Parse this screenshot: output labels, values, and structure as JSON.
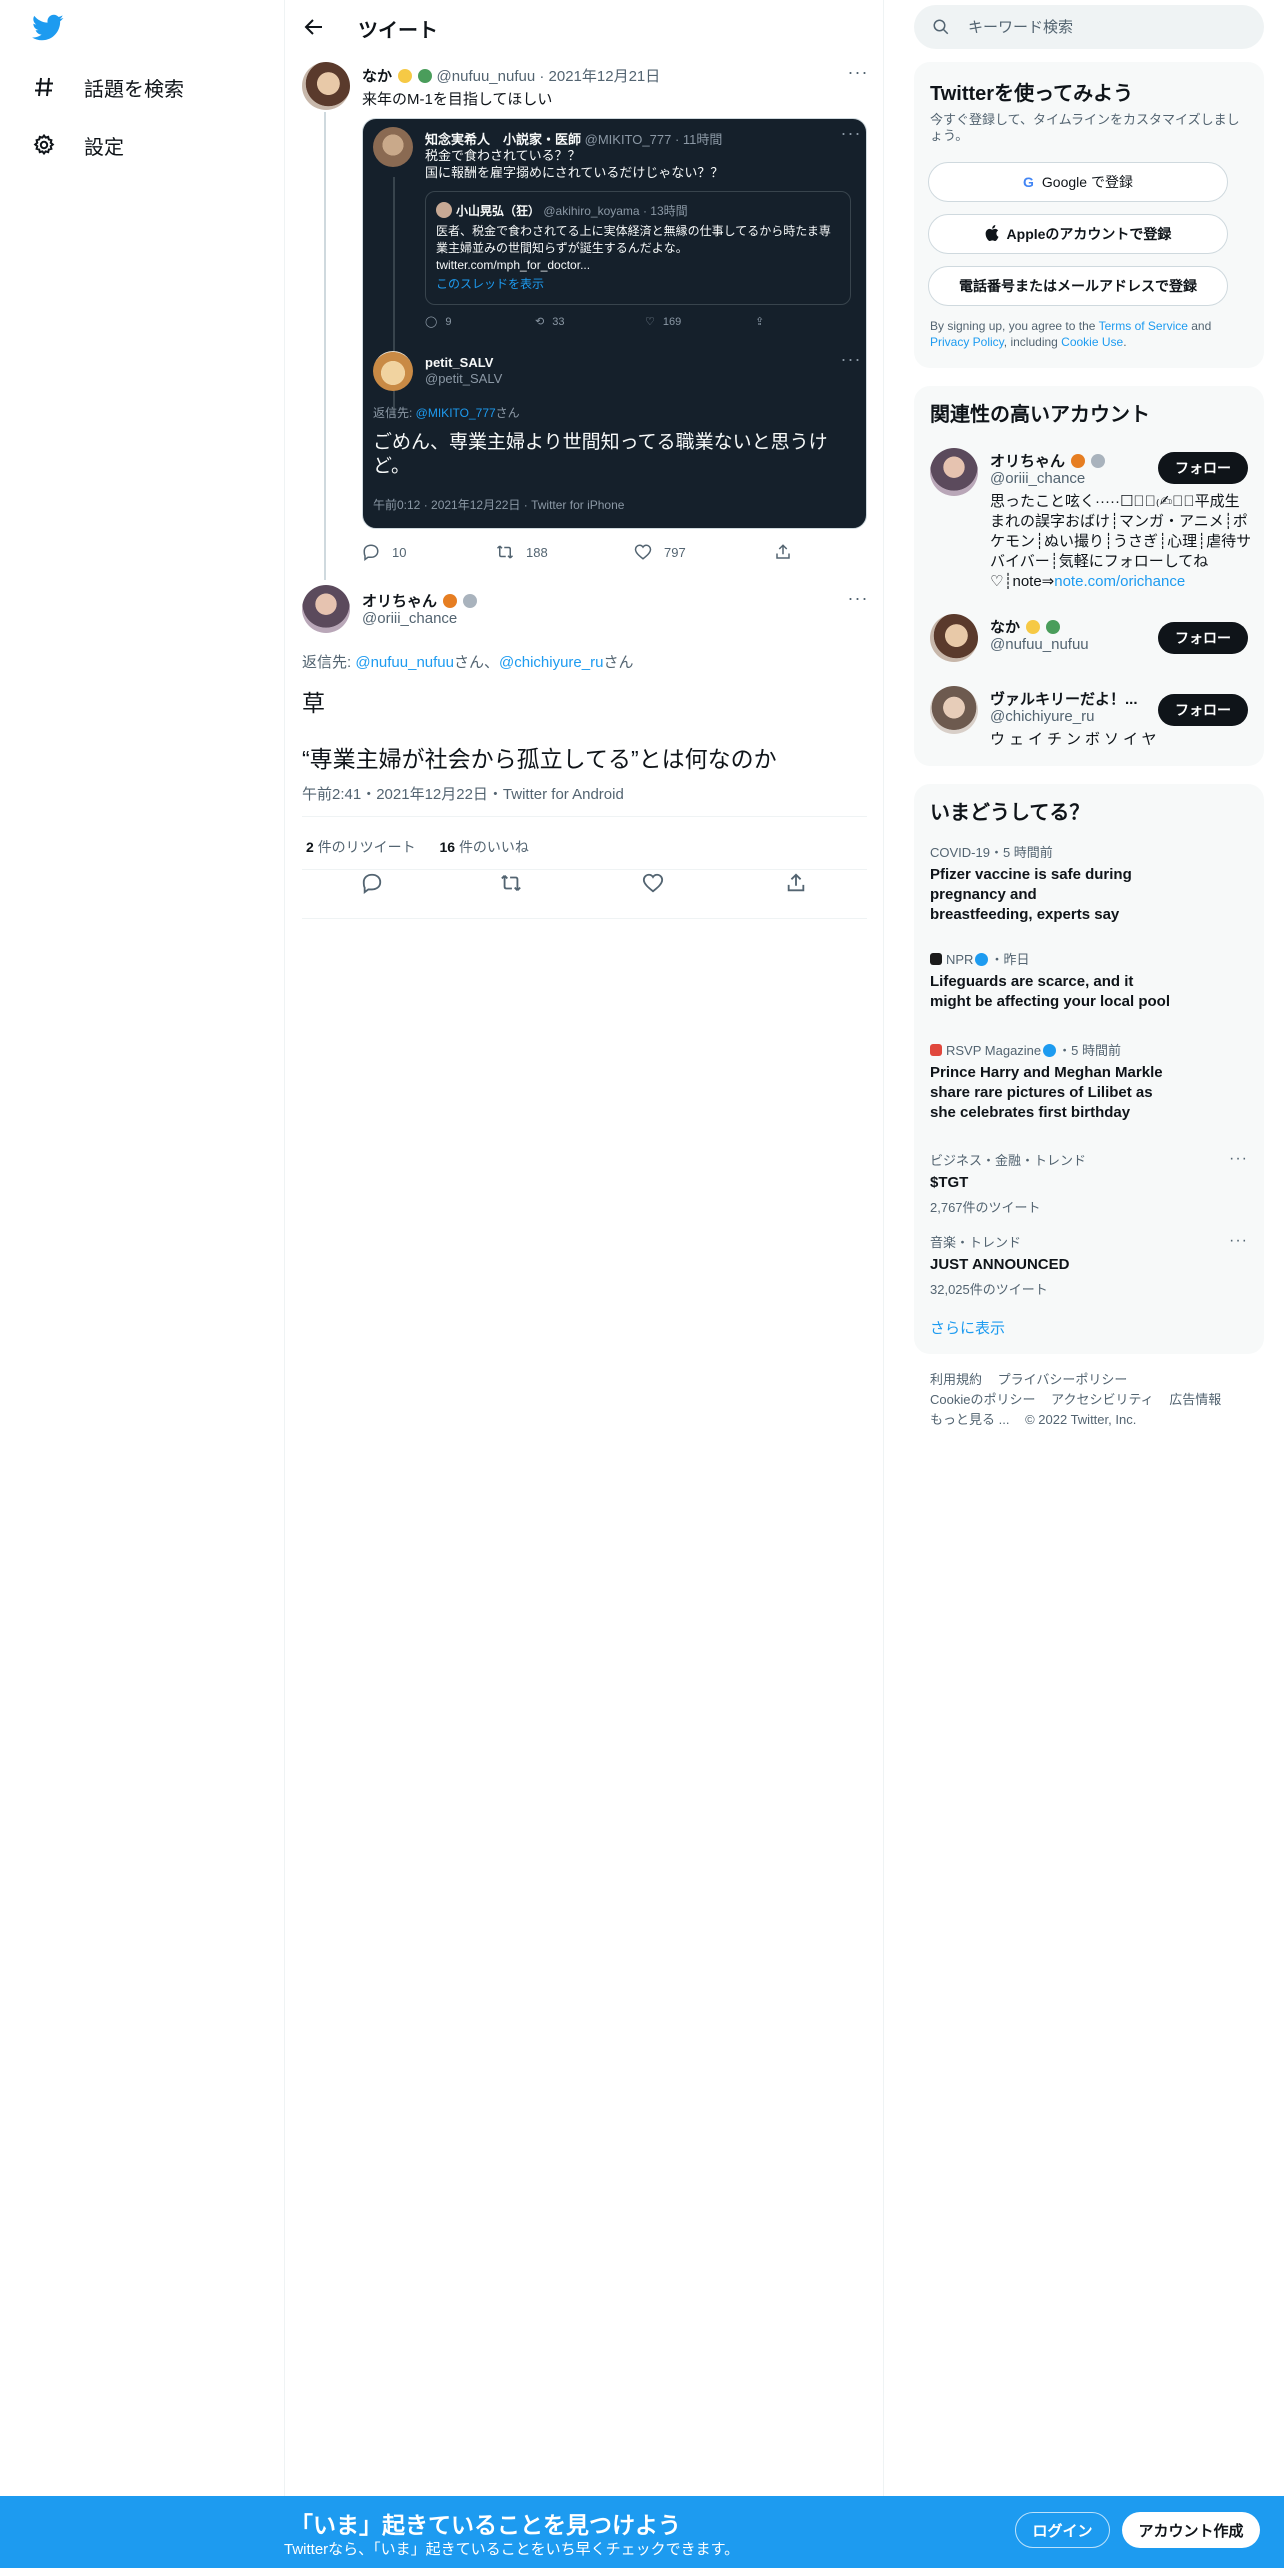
{
  "nav": {
    "explore_label": "話題を検索",
    "settings_label": "設定"
  },
  "header": {
    "title": "ツイート"
  },
  "parent_tweet": {
    "display_name": "なか",
    "handle": "@nufuu_nufuu",
    "date": "2021年12月21日",
    "text": "来年のM-1を目指してほしい",
    "embedded": {
      "top": {
        "name": "知念実希人　小説家・医師",
        "handle": "@MIKITO_777",
        "time": "11時間",
        "text1": "税金で食わされている？？",
        "text2": "国に報酬を雇字搦めにされているだけじゃない？？"
      },
      "quote": {
        "name": "小山晃弘（狂）",
        "handle": "@akihiro_koyama",
        "time": "13時間",
        "text": "医者、税金で食わされてる上に実体経済と無縁の仕事してるから時たま専業主婦並みの世間知らずが誕生するんだよな。",
        "link": "twitter.com/mph_for_doctor...",
        "thread": "このスレッドを表示"
      },
      "top_counts": {
        "replies": "9",
        "retweets": "33",
        "likes": "169"
      },
      "reply": {
        "name": "petit_SALV",
        "handle": "@petit_SALV",
        "reply_prefix": "返信先: ",
        "reply_to": "@MIKITO_777",
        "reply_suffix": "さん",
        "text": "ごめん、専業主婦より世間知ってる職業ないと思うけど。",
        "meta": "午前0:12 · 2021年12月22日 · Twitter for iPhone"
      }
    },
    "counts": {
      "replies": "10",
      "retweets": "188",
      "likes": "797"
    }
  },
  "main_tweet": {
    "display_name": "オリちゃん",
    "handle": "@oriii_chance",
    "reply_prefix": "返信先: ",
    "reply_to_1": "@nufuu_nufuu",
    "reply_mid": "さん、",
    "reply_to_2": "@chichiyure_ru",
    "reply_suffix": "さん",
    "line1": "草",
    "line2": "“専業主婦が社会から孤立してる”とは何なのか",
    "meta": "午前2:41・2021年12月22日・Twitter for Android",
    "retweets_count": "2",
    "retweets_label": "件のリツイート",
    "likes_count": "16",
    "likes_label": "件のいいね"
  },
  "search": {
    "placeholder": "キーワード検索"
  },
  "signup_panel": {
    "title": "Twitterを使ってみよう",
    "subtitle": "今すぐ登録して、タイムラインをカスタマイズしましょう。",
    "google": "Google で登録",
    "apple": "Appleのアカウントで登録",
    "phone": "電話番号またはメールアドレスで登録",
    "legal_1": "By signing up, you agree to the ",
    "legal_tos": "Terms of Service",
    "legal_2": " and ",
    "legal_pp": "Privacy Policy",
    "legal_3": ", including ",
    "legal_cookie": "Cookie Use",
    "legal_4": "."
  },
  "related": {
    "title": "関連性の高いアカウント",
    "follow_label": "フォロー",
    "accounts": [
      {
        "name": "オリちゃん",
        "handle": "@oriii_chance",
        "bio": "思ったこと呟く·····☐☐ﾞ₍✍︎₎ﾟ平成生まれの誤字おばけ┊マンガ・アニメ┊ポケモン┊ぬい撮り┊うさぎ┊心理┊虐待サバイバー┊気軽にフォローしてね♡┊note⇒",
        "bio_link": "note.com/orichance"
      },
      {
        "name": "なか",
        "handle": "@nufuu_nufuu",
        "bio": ""
      },
      {
        "name": "ヴァルキリーだよ！...",
        "handle": "@chichiyure_ru",
        "bio": "ウェイチンボソイヤ"
      }
    ]
  },
  "trends": {
    "title": "いまどうしてる？",
    "items": [
      {
        "category": "COVID-19・5 時間前",
        "title": "Pfizer vaccine is safe during pregnancy and breastfeeding, experts say",
        "count": ""
      },
      {
        "category": "NPR",
        "category_time": "・昨日",
        "title": "Lifeguards are scarce, and it might be affecting your local pool",
        "count": ""
      },
      {
        "category": "RSVP Magazine",
        "category_time": "・5 時間前",
        "title": "Prince Harry and Meghan Markle share rare pictures of Lilibet as she celebrates first birthday",
        "count": ""
      },
      {
        "category": "ビジネス・金融・トレンド",
        "title": "$TGT",
        "count": "2,767件のツイート"
      },
      {
        "category": "音楽・トレンド",
        "title": "JUST ANNOUNCED",
        "count": "32,025件のツイート"
      }
    ],
    "show_more": "さらに表示"
  },
  "footer": {
    "terms": "利用規約",
    "privacy": "プライバシーポリシー",
    "cookie": "Cookieのポリシー",
    "accessibility": "アクセシビリティ",
    "ads": "広告情報",
    "more": "もっと見る ...",
    "copyright": "© 2022 Twitter, Inc."
  },
  "bottom_bar": {
    "title": "「いま」起きていることを見つけよう",
    "subtitle": "Twitterなら、「いま」起きていることをいち早くチェックできます。",
    "login": "ログイン",
    "signup": "アカウント作成"
  },
  "colors": {
    "accent": "#1d9bf0",
    "text": "#0f1419",
    "secondary": "#536471",
    "dark_card": "#15202b"
  }
}
